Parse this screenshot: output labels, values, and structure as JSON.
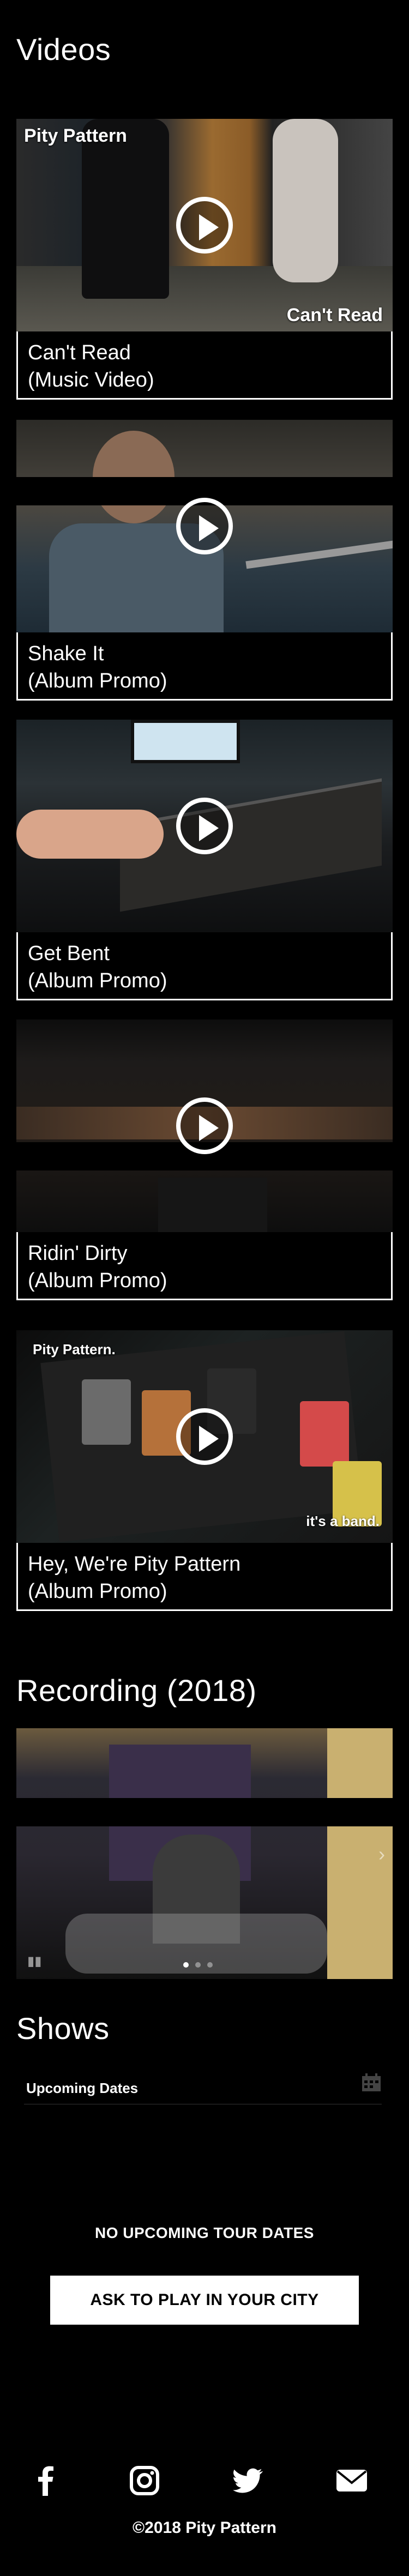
{
  "videos": {
    "title": "Videos",
    "items": [
      {
        "caption_line1": "Can't Read",
        "caption_line2": "(Music Video)",
        "overlay_top": "Pity Pattern",
        "overlay_bottom": "Can't Read"
      },
      {
        "caption_line1": "Shake It",
        "caption_line2": "(Album Promo)"
      },
      {
        "caption_line1": "Get Bent",
        "caption_line2": "(Album Promo)"
      },
      {
        "caption_line1": "Ridin' Dirty",
        "caption_line2": "(Album Promo)"
      },
      {
        "caption_line1": "Hey, We're Pity Pattern",
        "caption_line2": "(Album Promo)",
        "overlay_top": "Pity Pattern.",
        "overlay_bottom": "it's a band."
      }
    ]
  },
  "recording": {
    "title": "Recording (2018)",
    "slide_count": 3,
    "active_slide": 1
  },
  "shows": {
    "title": "Shows",
    "upcoming_label": "Upcoming Dates",
    "no_dates": "NO UPCOMING TOUR DATES",
    "ask_button": "ASK TO PLAY IN YOUR CITY"
  },
  "footer": {
    "social": [
      "facebook-icon",
      "instagram-icon",
      "twitter-icon",
      "email-icon"
    ],
    "copyright": "©2018 Pity Pattern"
  },
  "colors": {
    "background": "#000000",
    "text": "#ffffff",
    "button_bg": "#ffffff",
    "button_text": "#000000"
  }
}
